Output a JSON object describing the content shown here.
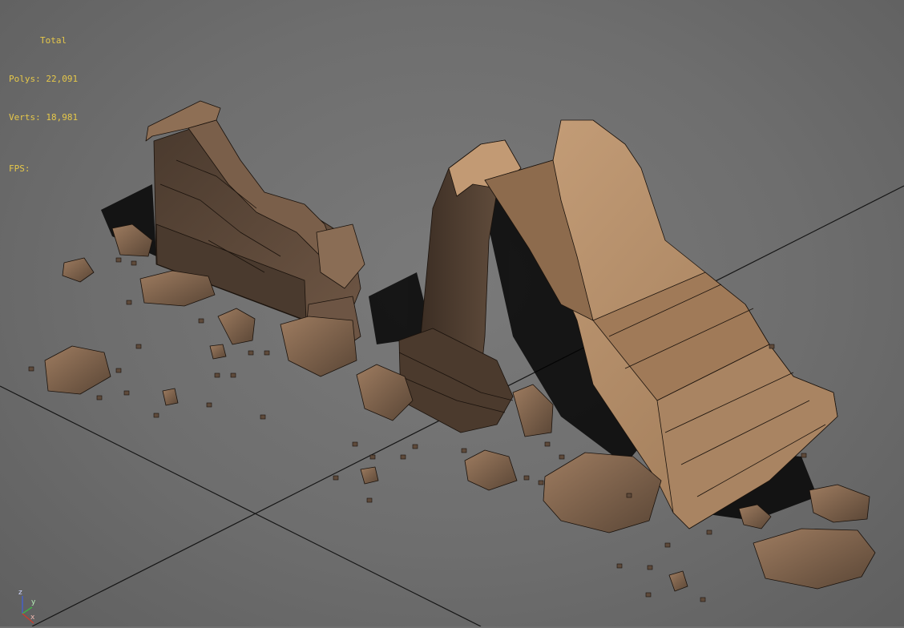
{
  "viewport": {
    "stats_title": "Total",
    "polys_label": "Polys:",
    "polys_value": "22,091",
    "verts_label": "Verts:",
    "verts_value": "18,981",
    "fps_label": "FPS:",
    "fps_value": "",
    "axis_labels": {
      "x": "x",
      "y": "y",
      "z": "z"
    },
    "colors": {
      "background": "#6f6f6f",
      "stats_text": "#e6c84a",
      "grid_line": "#1a1a1a",
      "stone_dark": "#5b4636",
      "stone_light": "#b48c64",
      "shadow": "#000000",
      "axis_x": "#d03a2a",
      "axis_y": "#3ac040",
      "axis_z": "#4060e0"
    }
  }
}
